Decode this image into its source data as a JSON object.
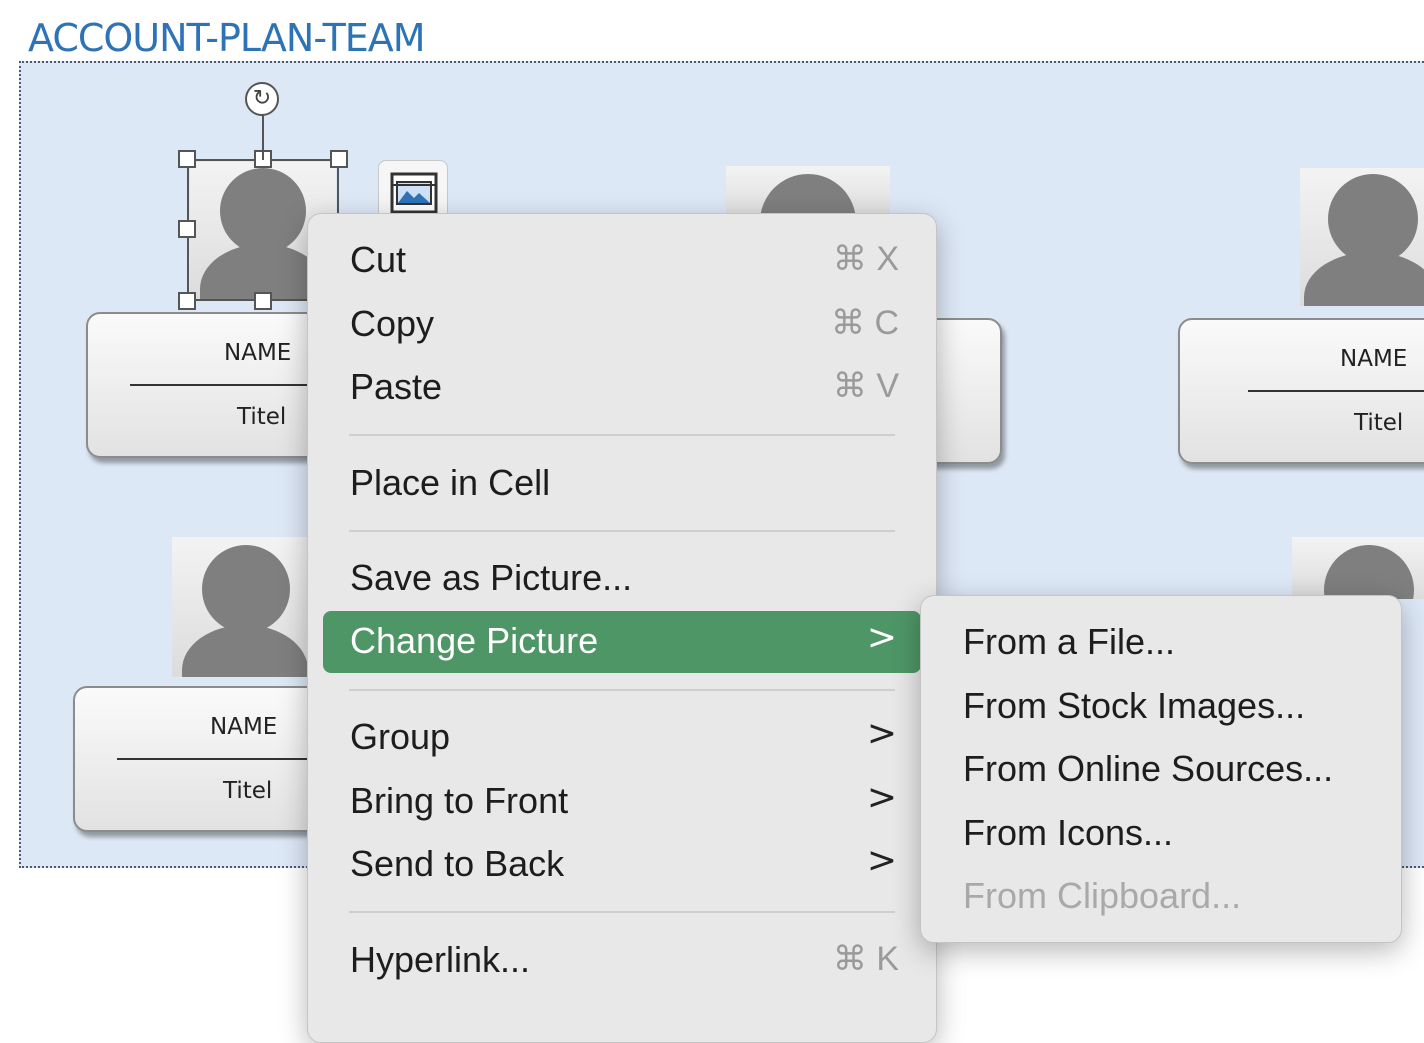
{
  "sheet": {
    "title": "ACCOUNT-PLAN-TEAM"
  },
  "cards": [
    {
      "name": "NAME",
      "title": "Titel"
    },
    {
      "name": "NAME",
      "title": "Titel"
    },
    {
      "name": "NAME",
      "title": "Titel"
    }
  ],
  "context_menu": {
    "items": [
      {
        "label": "Cut",
        "shortcut": "⌘ X"
      },
      {
        "label": "Copy",
        "shortcut": "⌘ C"
      },
      {
        "label": "Paste",
        "shortcut": "⌘ V"
      },
      {
        "label": "Place in Cell"
      },
      {
        "label": "Save as Picture..."
      },
      {
        "label": "Change Picture",
        "submenu_arrow": ">",
        "state": "highlighted"
      },
      {
        "label": "Group",
        "submenu_arrow": ">"
      },
      {
        "label": "Bring to Front",
        "submenu_arrow": ">"
      },
      {
        "label": "Send to Back",
        "submenu_arrow": ">"
      },
      {
        "label": "Hyperlink...",
        "shortcut": "⌘ K"
      }
    ]
  },
  "submenu": {
    "items": [
      {
        "label": "From a File..."
      },
      {
        "label": "From Stock Images..."
      },
      {
        "label": "From Online Sources..."
      },
      {
        "label": "From Icons..."
      },
      {
        "label": "From Clipboard...",
        "state": "disabled"
      }
    ]
  },
  "icons": {
    "rotate": "↻"
  },
  "colors": {
    "highlight": "#4e9666",
    "title": "#2f73b7",
    "canvas": "#dde8f6"
  }
}
